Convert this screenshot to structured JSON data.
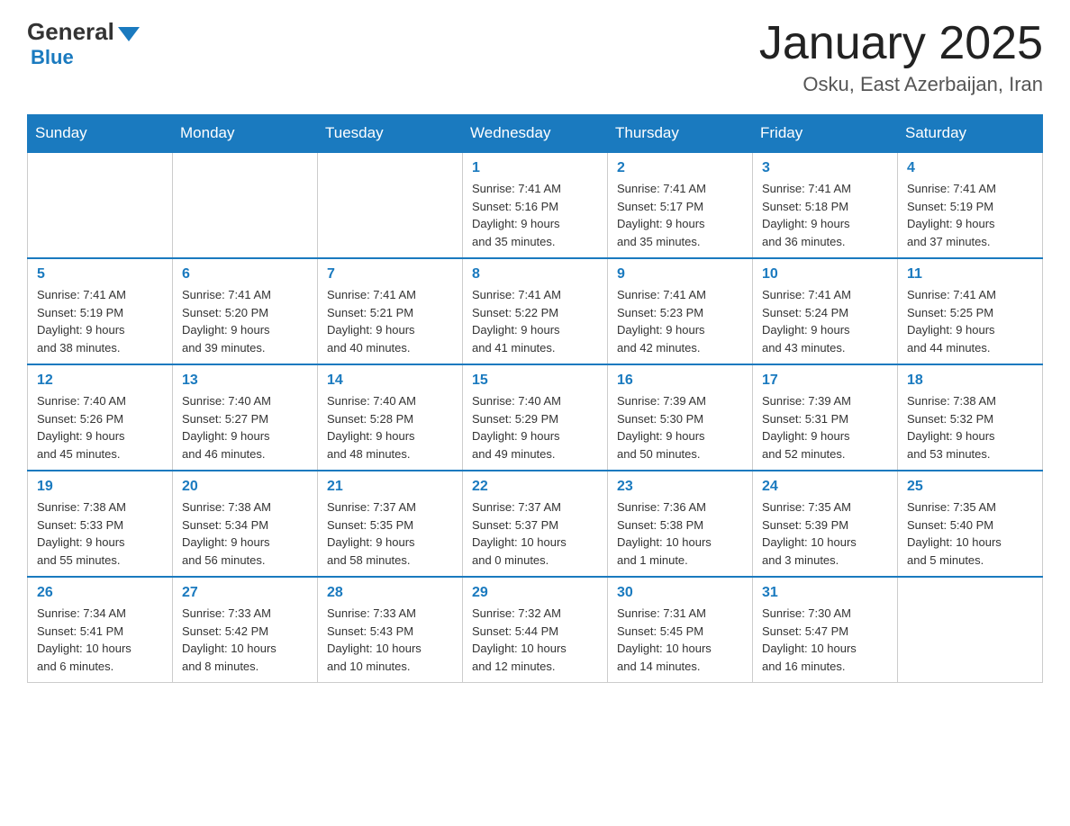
{
  "header": {
    "logo_text_general": "General",
    "logo_text_blue": "Blue",
    "title": "January 2025",
    "subtitle": "Osku, East Azerbaijan, Iran"
  },
  "days_of_week": [
    "Sunday",
    "Monday",
    "Tuesday",
    "Wednesday",
    "Thursday",
    "Friday",
    "Saturday"
  ],
  "weeks": [
    [
      {
        "day": "",
        "info": ""
      },
      {
        "day": "",
        "info": ""
      },
      {
        "day": "",
        "info": ""
      },
      {
        "day": "1",
        "info": "Sunrise: 7:41 AM\nSunset: 5:16 PM\nDaylight: 9 hours\nand 35 minutes."
      },
      {
        "day": "2",
        "info": "Sunrise: 7:41 AM\nSunset: 5:17 PM\nDaylight: 9 hours\nand 35 minutes."
      },
      {
        "day": "3",
        "info": "Sunrise: 7:41 AM\nSunset: 5:18 PM\nDaylight: 9 hours\nand 36 minutes."
      },
      {
        "day": "4",
        "info": "Sunrise: 7:41 AM\nSunset: 5:19 PM\nDaylight: 9 hours\nand 37 minutes."
      }
    ],
    [
      {
        "day": "5",
        "info": "Sunrise: 7:41 AM\nSunset: 5:19 PM\nDaylight: 9 hours\nand 38 minutes."
      },
      {
        "day": "6",
        "info": "Sunrise: 7:41 AM\nSunset: 5:20 PM\nDaylight: 9 hours\nand 39 minutes."
      },
      {
        "day": "7",
        "info": "Sunrise: 7:41 AM\nSunset: 5:21 PM\nDaylight: 9 hours\nand 40 minutes."
      },
      {
        "day": "8",
        "info": "Sunrise: 7:41 AM\nSunset: 5:22 PM\nDaylight: 9 hours\nand 41 minutes."
      },
      {
        "day": "9",
        "info": "Sunrise: 7:41 AM\nSunset: 5:23 PM\nDaylight: 9 hours\nand 42 minutes."
      },
      {
        "day": "10",
        "info": "Sunrise: 7:41 AM\nSunset: 5:24 PM\nDaylight: 9 hours\nand 43 minutes."
      },
      {
        "day": "11",
        "info": "Sunrise: 7:41 AM\nSunset: 5:25 PM\nDaylight: 9 hours\nand 44 minutes."
      }
    ],
    [
      {
        "day": "12",
        "info": "Sunrise: 7:40 AM\nSunset: 5:26 PM\nDaylight: 9 hours\nand 45 minutes."
      },
      {
        "day": "13",
        "info": "Sunrise: 7:40 AM\nSunset: 5:27 PM\nDaylight: 9 hours\nand 46 minutes."
      },
      {
        "day": "14",
        "info": "Sunrise: 7:40 AM\nSunset: 5:28 PM\nDaylight: 9 hours\nand 48 minutes."
      },
      {
        "day": "15",
        "info": "Sunrise: 7:40 AM\nSunset: 5:29 PM\nDaylight: 9 hours\nand 49 minutes."
      },
      {
        "day": "16",
        "info": "Sunrise: 7:39 AM\nSunset: 5:30 PM\nDaylight: 9 hours\nand 50 minutes."
      },
      {
        "day": "17",
        "info": "Sunrise: 7:39 AM\nSunset: 5:31 PM\nDaylight: 9 hours\nand 52 minutes."
      },
      {
        "day": "18",
        "info": "Sunrise: 7:38 AM\nSunset: 5:32 PM\nDaylight: 9 hours\nand 53 minutes."
      }
    ],
    [
      {
        "day": "19",
        "info": "Sunrise: 7:38 AM\nSunset: 5:33 PM\nDaylight: 9 hours\nand 55 minutes."
      },
      {
        "day": "20",
        "info": "Sunrise: 7:38 AM\nSunset: 5:34 PM\nDaylight: 9 hours\nand 56 minutes."
      },
      {
        "day": "21",
        "info": "Sunrise: 7:37 AM\nSunset: 5:35 PM\nDaylight: 9 hours\nand 58 minutes."
      },
      {
        "day": "22",
        "info": "Sunrise: 7:37 AM\nSunset: 5:37 PM\nDaylight: 10 hours\nand 0 minutes."
      },
      {
        "day": "23",
        "info": "Sunrise: 7:36 AM\nSunset: 5:38 PM\nDaylight: 10 hours\nand 1 minute."
      },
      {
        "day": "24",
        "info": "Sunrise: 7:35 AM\nSunset: 5:39 PM\nDaylight: 10 hours\nand 3 minutes."
      },
      {
        "day": "25",
        "info": "Sunrise: 7:35 AM\nSunset: 5:40 PM\nDaylight: 10 hours\nand 5 minutes."
      }
    ],
    [
      {
        "day": "26",
        "info": "Sunrise: 7:34 AM\nSunset: 5:41 PM\nDaylight: 10 hours\nand 6 minutes."
      },
      {
        "day": "27",
        "info": "Sunrise: 7:33 AM\nSunset: 5:42 PM\nDaylight: 10 hours\nand 8 minutes."
      },
      {
        "day": "28",
        "info": "Sunrise: 7:33 AM\nSunset: 5:43 PM\nDaylight: 10 hours\nand 10 minutes."
      },
      {
        "day": "29",
        "info": "Sunrise: 7:32 AM\nSunset: 5:44 PM\nDaylight: 10 hours\nand 12 minutes."
      },
      {
        "day": "30",
        "info": "Sunrise: 7:31 AM\nSunset: 5:45 PM\nDaylight: 10 hours\nand 14 minutes."
      },
      {
        "day": "31",
        "info": "Sunrise: 7:30 AM\nSunset: 5:47 PM\nDaylight: 10 hours\nand 16 minutes."
      },
      {
        "day": "",
        "info": ""
      }
    ]
  ]
}
